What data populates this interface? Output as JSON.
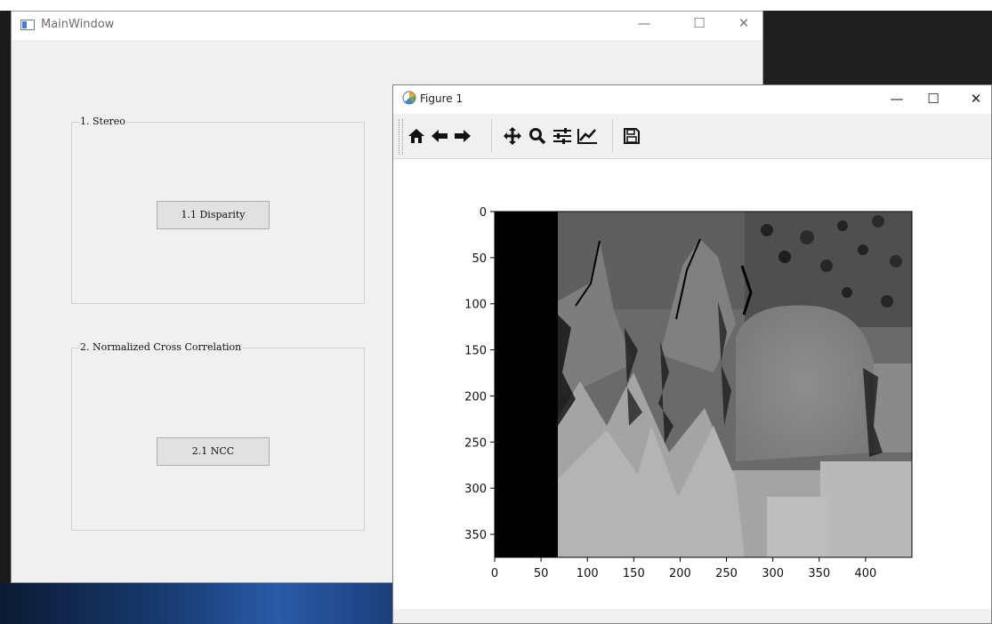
{
  "main_window": {
    "title": "MainWindow",
    "controls": {
      "minimize": "—",
      "maximize": "☐",
      "close": "✕"
    },
    "group_stereo": {
      "title": "1. Stereo",
      "button_label": "1.1 Disparity"
    },
    "group_ncc": {
      "title": "2. Normalized Cross Correlation",
      "button_label": "2.1 NCC"
    }
  },
  "figure_window": {
    "title": "Figure 1",
    "controls": {
      "minimize": "—",
      "maximize": "☐",
      "close": "✕"
    },
    "toolbar": [
      "home-icon",
      "back-arrow-icon",
      "forward-arrow-icon",
      "pan-icon",
      "zoom-icon",
      "configure-subplots-icon",
      "edit-axes-icon",
      "save-icon"
    ]
  },
  "chart_data": {
    "type": "image",
    "title": "",
    "xlabel": "",
    "ylabel": "",
    "x_ticks": [
      0,
      50,
      100,
      150,
      200,
      250,
      300,
      350,
      400
    ],
    "y_ticks": [
      0,
      50,
      100,
      150,
      200,
      250,
      300,
      350
    ],
    "xlim": [
      0,
      450
    ],
    "ylim": [
      375,
      0
    ],
    "grid": false,
    "colormap": "gray"
  }
}
